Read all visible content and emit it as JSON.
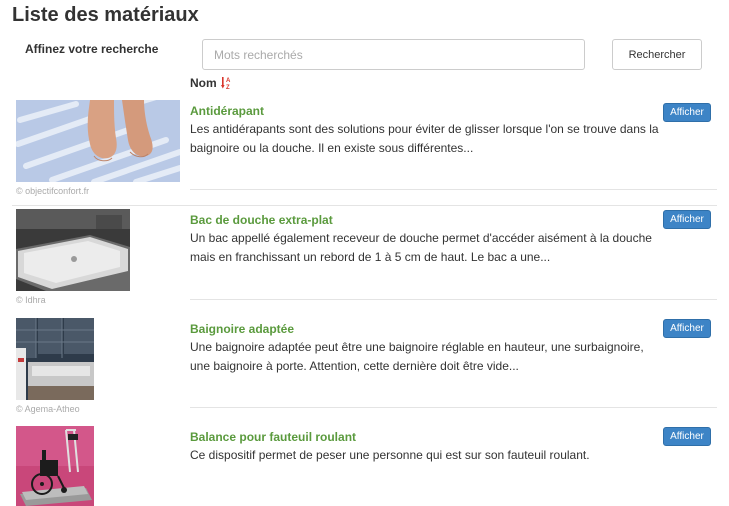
{
  "page": {
    "title": "Liste des matériaux"
  },
  "search": {
    "refine_label": "Affinez votre recherche",
    "placeholder": "Mots recherchés",
    "value": "",
    "button_label": "Rechercher"
  },
  "sort": {
    "label": "Nom",
    "icon": "sort-alpha-icon",
    "icon_color": "#d9352b"
  },
  "colors": {
    "title_green": "#5a9a3d",
    "button_blue": "#3d84c6"
  },
  "items": [
    {
      "title": "Antidérapant",
      "description": "Les antidérapants sont des solutions pour éviter de glisser lorsque l'on se trouve dans la baignoire ou la douche. Il en existe sous différentes...",
      "credit": "© objectifconfort.fr",
      "button_label": "Afficher",
      "image": "bath-mat-feet-photo"
    },
    {
      "title": "Bac de douche extra-plat",
      "description": "Un bac appellé également receveur de douche permet d'accéder aisément à la douche mais en franchissant un rebord de 1 à 5 cm de haut. Le bac a une...",
      "credit": "© Idhra",
      "button_label": "Afficher",
      "image": "shower-tray-photo"
    },
    {
      "title": "Baignoire adaptée",
      "description": "Une baignoire adaptée peut être une baignoire réglable en hauteur, une surbaignoire, une baignoire à porte. Attention, cette dernière doit être vide...",
      "credit": "© Agema-Atheo",
      "button_label": "Afficher",
      "image": "adapted-bathtub-photo"
    },
    {
      "title": "Balance pour fauteuil roulant",
      "description": "Ce dispositif permet de peser une personne qui est sur son fauteuil roulant.",
      "credit": "",
      "button_label": "Afficher",
      "image": "wheelchair-scale-photo"
    }
  ]
}
